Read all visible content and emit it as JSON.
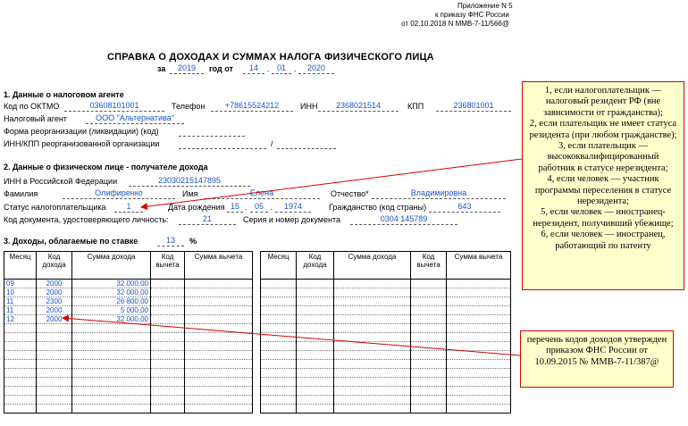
{
  "header": {
    "line1": "Приложение N 5",
    "line2": "к приказу ФНС России",
    "line3": "от 02.10.2018 N ММВ-7-11/566@"
  },
  "title": "СПРАВКА О ДОХОДАХ И СУММАХ НАЛОГА ФИЗИЧЕСКОГО ЛИЦА",
  "period": {
    "za": "за",
    "year": "2019",
    "god_ot": "год  от",
    "day": "14",
    "month": "01",
    "doc_year": "2020"
  },
  "section1": {
    "title": "1. Данные о налоговом агенте",
    "oktmo_label": "Код по ОКТМО",
    "oktmo": "03608101001",
    "phone_label": "Телефон",
    "phone": "+78615524212",
    "inn_label": "ИНН",
    "inn": "2368021514",
    "kpp_label": "КПП",
    "kpp": "236801001",
    "agent_label": "Налоговый агент",
    "agent": "ООО \"Альтернатива\"",
    "reorg_label": "Форма реорганизации (ликвидации) (код)",
    "reorg_inn_label": "ИНН/КПП реорганизованной организации",
    "slash": "/"
  },
  "section2": {
    "title": "2. Данные о физическом лице - получателе дохода",
    "inn_label": "ИНН в Российской Федерации",
    "inn": "230302151478​95",
    "surname_label": "Фамилия",
    "surname": "Олифиренко",
    "name_label": "Имя",
    "name": "Елена",
    "patronymic_label": "Отчество*",
    "patronymic": "Владимировна",
    "status_label": "Статус налогоплательщика",
    "status": "1",
    "birth_label": "Дата рождения",
    "birth_day": "15",
    "birth_month": "05",
    "birth_year": "1974",
    "citizenship_label": "Гражданство (код страны)",
    "citizenship": "643",
    "doc_code_label": "Код документа, удостоверяющего личность:",
    "doc_code": "21",
    "doc_number_label": "Серия и номер документа",
    "doc_number": "0304 145789"
  },
  "section3": {
    "title": "3. Доходы, облагаемые по ставке",
    "rate": "13",
    "percent": "%",
    "columns": [
      "Месяц",
      "Код дохода",
      "Сумма дохода",
      "Код вычета",
      "Сумма вычета"
    ],
    "rows": [
      {
        "month": "09",
        "code": "2000",
        "amount": "32 000,00"
      },
      {
        "month": "10",
        "code": "2000",
        "amount": "32 000,00"
      },
      {
        "month": "11",
        "code": "2300",
        "amount": "26 800,00"
      },
      {
        "month": "11",
        "code": "2000",
        "amount": "5 000,00"
      },
      {
        "month": "12",
        "code": "2000",
        "amount": "32 000,00"
      }
    ]
  },
  "notes": {
    "status_codes": [
      "1, если налогоплательщик — налоговый резидент РФ (вне зависимости от гражданства);",
      "2, если плательщик не имеет статуса резидента (при любом гражданстве);",
      "3, если плательщик — высококвалифицированный работник в статусе нерезидента;",
      "4, если человек — участник программы переселения в статусе нерезидента;",
      "5, если человек — иностранец-нерезидент, получивший убежище;",
      "6, если человек — иностранец, работающий по патенту"
    ],
    "income_codes": "перечень кодов доходов утвержден приказом ФНС России от 10.09.2015 № ММВ-7-11/387@"
  },
  "colors": {
    "value_text": "#1a53c9",
    "note_bg": "#ffffcc",
    "note_border": "#d40000",
    "arrow": "#d40000"
  }
}
